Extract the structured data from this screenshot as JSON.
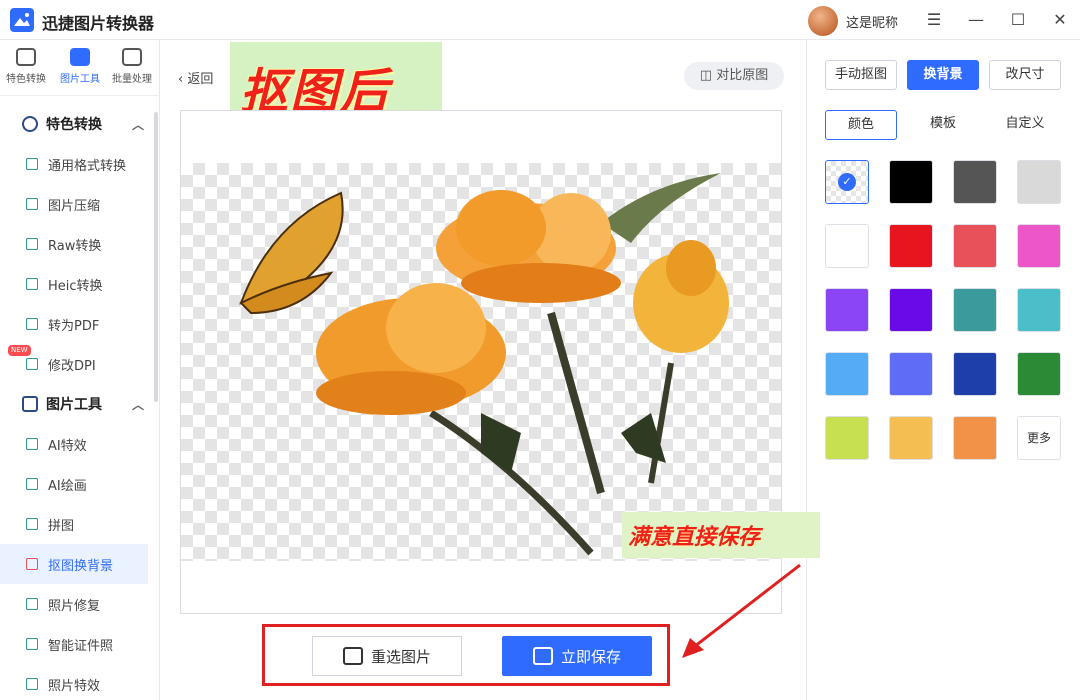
{
  "app": {
    "title": "迅捷图片转换器",
    "nickname": "这是昵称"
  },
  "window_controls": {
    "menu": "☰",
    "minimize": "—",
    "maximize": "☐",
    "close": "✕"
  },
  "left_tabs": [
    "特色转换",
    "图片工具",
    "批量处理"
  ],
  "sidebar": {
    "section1": {
      "title": "特色转换",
      "items": [
        "通用格式转换",
        "图片压缩",
        "Raw转换",
        "Heic转换",
        "转为PDF",
        "修改DPI"
      ],
      "new_badge": "NEW"
    },
    "section2": {
      "title": "图片工具",
      "items": [
        "AI特效",
        "AI绘画",
        "拼图",
        "抠图换背景",
        "照片修复",
        "智能证件照",
        "照片特效"
      ],
      "active": "抠图换背景"
    }
  },
  "main": {
    "back_label": "返回",
    "compare_label": "对比原图",
    "stamp_text": "抠图后",
    "reselect_label": "重选图片",
    "save_label": "立即保存",
    "hint_text": "满意直接保存"
  },
  "right_panel": {
    "modes": [
      "手动抠图",
      "换背景",
      "改尺寸"
    ],
    "active_mode": "换背景",
    "sub_tabs": [
      "颜色",
      "模板",
      "自定义"
    ],
    "active_sub_tab": "颜色",
    "more_label": "更多",
    "colors": [
      "transparent",
      "#000000",
      "#555555",
      "#d9d9d9",
      "#ffffff",
      "#e8141e",
      "#e8505a",
      "#ec56c8",
      "#8c45f5",
      "#6a0ae6",
      "#3a9a9c",
      "#4bbfc9",
      "#55acf6",
      "#5e6cf6",
      "#1f3fa8",
      "#2a8a35",
      "#c7e050",
      "#f4be52",
      "#f29248"
    ]
  }
}
